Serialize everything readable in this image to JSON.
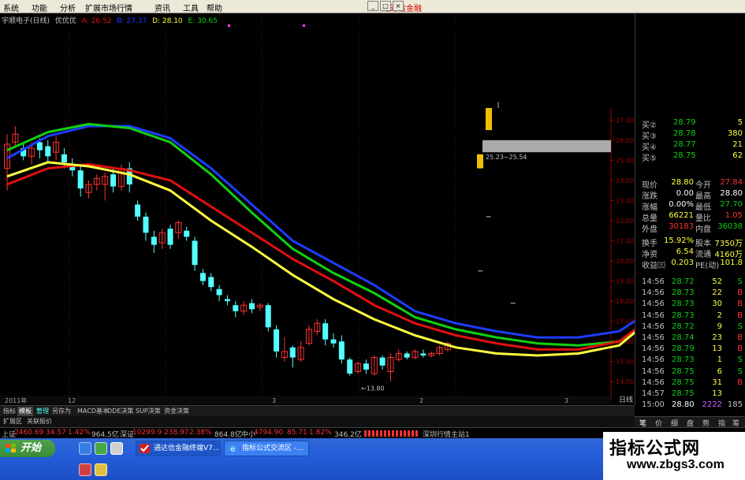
{
  "menu": {
    "items": [
      "系统",
      "功能",
      "分析",
      "扩展市场行情",
      "资讯",
      "工具",
      "帮助"
    ],
    "brand": "通达信金融"
  },
  "info_bar": {
    "stock": "宇顺电子(日线)",
    "indicator": "优优优",
    "a_label": "A: 26.52",
    "b_label": "B: 27.37",
    "d_label": "D: 28.10",
    "e_label": "E: 30.65"
  },
  "colors": {
    "up_candle": "#ff3232",
    "down_candle": "#54ffff",
    "line_blue": "#1e3cff",
    "line_green": "#10d010",
    "line_red": "#e01010",
    "line_yellow": "#ffff40",
    "grid": "#800000"
  },
  "chart_data": {
    "type": "line",
    "title": "",
    "y_axis_ticks": [
      "27.00",
      "26.00",
      "25.00",
      "24.00",
      "23.00",
      "22.00",
      "21.00",
      "20.00",
      "19.00",
      "18.00",
      "17.00",
      "16.00",
      "15.00",
      "14.00"
    ],
    "ylim": [
      13.5,
      27.6
    ],
    "x_axis_labels": [
      "2011年",
      "12",
      "3",
      "2",
      "3"
    ],
    "annotations": {
      "low_marker": "←13.80",
      "range_label": "25.23~25.54"
    },
    "candles": [
      [
        24.6,
        25.8,
        23.5,
        26.3
      ],
      [
        25.9,
        26.3,
        25.6,
        26.7
      ],
      [
        25.6,
        25.2,
        25.0,
        25.9
      ],
      [
        25.2,
        25.6,
        24.8,
        25.9
      ],
      [
        25.9,
        25.5,
        25.1,
        26.1
      ],
      [
        25.7,
        25.2,
        24.9,
        26.0
      ],
      [
        25.4,
        25.9,
        25.0,
        26.2
      ],
      [
        25.3,
        24.9,
        24.6,
        25.6
      ],
      [
        24.8,
        24.5,
        24.2,
        25.1
      ],
      [
        24.5,
        23.6,
        23.2,
        24.7
      ],
      [
        23.4,
        23.8,
        23.1,
        24.0
      ],
      [
        23.8,
        24.1,
        23.5,
        24.3
      ],
      [
        23.8,
        24.2,
        23.0,
        24.4
      ],
      [
        24.3,
        23.7,
        23.4,
        24.6
      ],
      [
        23.7,
        24.6,
        23.5,
        24.8
      ],
      [
        24.6,
        23.8,
        23.4,
        24.9
      ],
      [
        22.8,
        22.2,
        22.0,
        23.0
      ],
      [
        22.2,
        21.4,
        21.0,
        22.4
      ],
      [
        21.2,
        20.8,
        20.4,
        21.5
      ],
      [
        20.9,
        21.4,
        20.6,
        21.6
      ],
      [
        21.6,
        20.8,
        20.6,
        21.8
      ],
      [
        21.4,
        21.9,
        21.1,
        22.0
      ],
      [
        21.5,
        21.2,
        21.0,
        21.7
      ],
      [
        21.0,
        19.8,
        19.5,
        21.2
      ],
      [
        19.4,
        19.0,
        18.8,
        19.6
      ],
      [
        19.2,
        18.7,
        18.5,
        19.4
      ],
      [
        18.6,
        18.3,
        18.0,
        18.8
      ],
      [
        18.1,
        18.0,
        17.8,
        18.3
      ],
      [
        17.8,
        17.5,
        17.2,
        18.0
      ],
      [
        17.5,
        17.8,
        17.3,
        18.0
      ],
      [
        17.9,
        17.6,
        17.4,
        18.1
      ],
      [
        17.7,
        17.8,
        17.5,
        17.9
      ],
      [
        17.8,
        16.7,
        16.5,
        17.9
      ],
      [
        16.6,
        15.5,
        15.2,
        16.8
      ],
      [
        15.2,
        15.5,
        15.0,
        16.2
      ],
      [
        15.7,
        15.2,
        14.7,
        15.8
      ],
      [
        15.1,
        15.7,
        15.0,
        16.0
      ],
      [
        15.9,
        16.6,
        15.8,
        16.8
      ],
      [
        16.5,
        16.9,
        16.3,
        17.1
      ],
      [
        16.9,
        16.1,
        15.8,
        17.1
      ],
      [
        16.1,
        15.9,
        15.7,
        16.4
      ],
      [
        16.0,
        15.1,
        14.9,
        16.3
      ],
      [
        15.1,
        14.4,
        14.3,
        15.2
      ],
      [
        14.5,
        14.9,
        14.4,
        15.0
      ],
      [
        14.9,
        14.6,
        14.4,
        15.1
      ],
      [
        14.4,
        15.2,
        14.3,
        15.3
      ],
      [
        15.2,
        14.8,
        14.6,
        15.3
      ],
      [
        14.5,
        15.2,
        14.0,
        15.4
      ],
      [
        15.1,
        15.4,
        15.0,
        15.6
      ],
      [
        15.4,
        15.2,
        15.1,
        15.5
      ],
      [
        15.2,
        15.5,
        15.1,
        15.6
      ],
      [
        15.4,
        15.3,
        15.2,
        15.6
      ],
      [
        15.3,
        15.4,
        15.2,
        15.5
      ],
      [
        15.4,
        15.7,
        15.3,
        15.8
      ],
      [
        15.6,
        15.9,
        15.5,
        16.0
      ]
    ],
    "series": [
      {
        "color": "#1e3cff",
        "points": [
          [
            0,
            25.1
          ],
          [
            5,
            26.2
          ],
          [
            10,
            26.7
          ],
          [
            15,
            26.7
          ],
          [
            20,
            26.1
          ],
          [
            25,
            24.6
          ],
          [
            30,
            22.8
          ],
          [
            35,
            21.0
          ],
          [
            40,
            19.9
          ],
          [
            45,
            18.8
          ],
          [
            50,
            17.5
          ],
          [
            55,
            16.9
          ],
          [
            60,
            16.5
          ],
          [
            65,
            16.2
          ],
          [
            70,
            16.2
          ],
          [
            75,
            16.5
          ],
          [
            78,
            17.3
          ],
          [
            81,
            19.5
          ],
          [
            84,
            22.5
          ],
          [
            86,
            24.7
          ],
          [
            88,
            26.9
          ]
        ]
      },
      {
        "color": "#10d010",
        "points": [
          [
            0,
            25.5
          ],
          [
            5,
            26.4
          ],
          [
            10,
            26.8
          ],
          [
            15,
            26.6
          ],
          [
            20,
            25.9
          ],
          [
            25,
            24.3
          ],
          [
            30,
            22.4
          ],
          [
            35,
            20.6
          ],
          [
            40,
            19.4
          ],
          [
            45,
            18.4
          ],
          [
            50,
            17.2
          ],
          [
            55,
            16.6
          ],
          [
            60,
            16.2
          ],
          [
            65,
            15.9
          ],
          [
            70,
            15.8
          ],
          [
            75,
            16.0
          ],
          [
            78,
            16.8
          ],
          [
            81,
            18.8
          ],
          [
            84,
            21.8
          ],
          [
            87,
            24.5
          ],
          [
            89,
            26.3
          ]
        ]
      },
      {
        "color": "#e01010",
        "points": [
          [
            0,
            23.8
          ],
          [
            5,
            24.6
          ],
          [
            10,
            24.8
          ],
          [
            15,
            24.5
          ],
          [
            20,
            24.0
          ],
          [
            25,
            22.7
          ],
          [
            30,
            21.4
          ],
          [
            35,
            20.1
          ],
          [
            40,
            19.0
          ],
          [
            45,
            17.8
          ],
          [
            50,
            16.9
          ],
          [
            55,
            16.3
          ],
          [
            60,
            15.9
          ],
          [
            65,
            15.6
          ],
          [
            70,
            15.6
          ],
          [
            75,
            16.0
          ],
          [
            78,
            16.9
          ],
          [
            81,
            18.6
          ],
          [
            84,
            20.8
          ],
          [
            87,
            23.6
          ],
          [
            91,
            26.9
          ]
        ]
      },
      {
        "color": "#ffff40",
        "points": [
          [
            0,
            24.2
          ],
          [
            5,
            24.9
          ],
          [
            10,
            24.7
          ],
          [
            15,
            24.3
          ],
          [
            20,
            23.5
          ],
          [
            25,
            22.0
          ],
          [
            30,
            20.7
          ],
          [
            35,
            19.3
          ],
          [
            40,
            18.1
          ],
          [
            45,
            17.1
          ],
          [
            50,
            16.3
          ],
          [
            55,
            15.7
          ],
          [
            60,
            15.4
          ],
          [
            65,
            15.3
          ],
          [
            70,
            15.4
          ],
          [
            75,
            15.8
          ],
          [
            78,
            16.8
          ],
          [
            81,
            18.7
          ],
          [
            84,
            21.2
          ],
          [
            87,
            23.9
          ],
          [
            90,
            26.9
          ]
        ]
      }
    ]
  },
  "quote_panel": {
    "bids": [
      {
        "label": "买②",
        "price": "28.79",
        "vol": "5"
      },
      {
        "label": "买③",
        "price": "28.78",
        "vol": "380"
      },
      {
        "label": "买④",
        "price": "28.77",
        "vol": "21"
      },
      {
        "label": "买⑤",
        "price": "28.75",
        "vol": "62"
      }
    ],
    "stats": [
      {
        "k1": "现价",
        "v1": "28.80",
        "k2": "今开",
        "v2": "27.84"
      },
      {
        "k1": "涨跌",
        "v1": "0.00",
        "k2": "最高",
        "v2": "28.80"
      },
      {
        "k1": "涨幅",
        "v1": "0.00%",
        "k2": "最低",
        "v2": "27.70"
      },
      {
        "k1": "总量",
        "v1": "66221",
        "k2": "量比",
        "v2": "1.05"
      },
      {
        "k1": "外盘",
        "v1": "30183",
        "k2": "内盘",
        "v2": "36038"
      },
      {
        "k1": "换手",
        "v1": "15.92%",
        "k2": "股本",
        "v2": "7350万"
      },
      {
        "k1": "净资",
        "v1": "6.54",
        "k2": "流通",
        "v2": "4160万"
      },
      {
        "k1": "收益㈢",
        "v1": "0.203",
        "k2": "PE(动)",
        "v2": "101.8"
      }
    ],
    "ticks": [
      {
        "t": "14:56",
        "p": "28.72",
        "v": "52",
        "d": "S"
      },
      {
        "t": "14:56",
        "p": "28.73",
        "v": "22",
        "d": "B"
      },
      {
        "t": "14:56",
        "p": "28.73",
        "v": "30",
        "d": "B"
      },
      {
        "t": "14:56",
        "p": "28.73",
        "v": "2",
        "d": "B"
      },
      {
        "t": "14:56",
        "p": "28.72",
        "v": "9",
        "d": "S"
      },
      {
        "t": "14:56",
        "p": "28.74",
        "v": "23",
        "d": "B"
      },
      {
        "t": "14:56",
        "p": "28.79",
        "v": "13",
        "d": "B"
      },
      {
        "t": "14:56",
        "p": "28.73",
        "v": "1",
        "d": "S"
      },
      {
        "t": "14:56",
        "p": "28.75",
        "v": "6",
        "d": "S"
      },
      {
        "t": "14:56",
        "p": "28.75",
        "v": "31",
        "d": "B"
      },
      {
        "t": "14:57",
        "p": "28.75",
        "v": "13",
        "d": ""
      },
      {
        "t": "15:00",
        "p": "28.80",
        "v": "2222",
        "d": "185"
      }
    ]
  },
  "bottom_tabs": [
    "指标",
    "模板",
    "管理",
    "另存为",
    "MACD基本",
    "DDE决策",
    "SUP决策",
    "资金决策"
  ],
  "right_tabs": [
    "笔",
    "价",
    "细",
    "盘",
    "势",
    "指",
    "筹"
  ],
  "period_label": "日线",
  "ext_tabs": [
    "扩展区",
    "关联报价"
  ],
  "status": {
    "sh_label": "上证",
    "sh_value": "2460.69",
    "sh_change": "34.57",
    "sh_pct": "1.42%",
    "sh_amount": "964.5亿",
    "sz_label": "深证",
    "sz_value": "10299.9",
    "sz_change": "238.97",
    "sz_pct": "2.38%",
    "sz_amount": "864.8亿",
    "zx_label": "中小",
    "zx_value": "4794.90",
    "zx_change": "85.71",
    "zx_pct": "1.82%",
    "zx_amount": "346.2亿",
    "server": "深圳行情主站1"
  },
  "taskbar": {
    "start": "开始",
    "tasks": [
      "通达信金融终端V7...",
      "指标公式交流区 -..."
    ]
  },
  "watermark": {
    "title": "指标公式网",
    "url": "www.zbgs3.com"
  }
}
